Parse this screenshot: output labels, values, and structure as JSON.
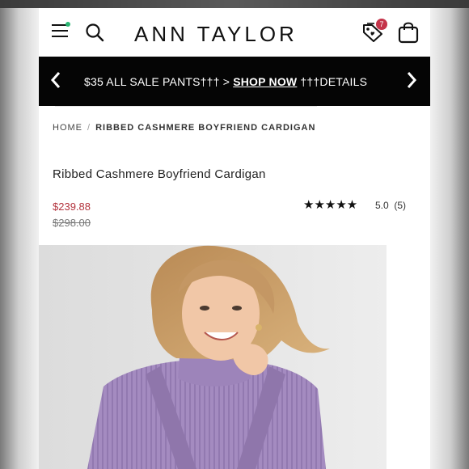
{
  "header": {
    "logo": "ANN TAYLOR",
    "wishlist_count": "7",
    "icons": [
      "menu-icon",
      "search-icon",
      "wishlist-tag-icon",
      "shopping-bag-icon"
    ]
  },
  "promo": {
    "text": "$35 ALL SALE PANTS††† > ",
    "link": "SHOP NOW",
    "details": " †††DETAILS"
  },
  "breadcrumb": {
    "home": "HOME",
    "separator": "/",
    "current": "RIBBED CASHMERE BOYFRIEND CARDIGAN"
  },
  "product": {
    "title": "Ribbed Cashmere Boyfriend Cardigan",
    "sale_price": "$239.88",
    "original_price": "$298.00",
    "stars": "★★★★★",
    "rating": "5.0",
    "review_count": "(5)"
  },
  "colors": {
    "sale_price": "#b3333d",
    "badge": "#c4344a",
    "notification_dot": "#2bb673",
    "promo_bg": "#050505",
    "sweater": "#a48bc0"
  }
}
